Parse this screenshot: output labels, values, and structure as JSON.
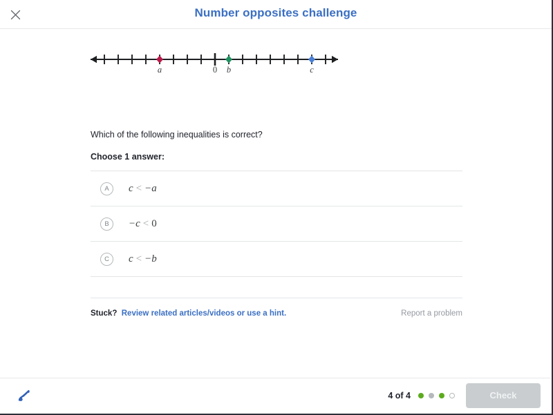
{
  "header": {
    "title": "Number opposites challenge",
    "close_icon": "close-icon"
  },
  "numberline": {
    "zero_label": "0",
    "points": [
      {
        "id": "a",
        "label": "a",
        "value": -4,
        "color": "#b81a4a"
      },
      {
        "id": "b",
        "label": "b",
        "value": 1,
        "color": "#1f9160"
      },
      {
        "id": "c",
        "label": "c",
        "value": 7,
        "color": "#4a7fd4"
      }
    ],
    "tick_min": -8,
    "tick_max": 8,
    "axis_color": "#1d1f21"
  },
  "question": {
    "prompt": "Which of the following inequalities is correct?",
    "choose_label": "Choose 1 answer:"
  },
  "options": [
    {
      "letter": "A",
      "lhs": "c",
      "rel": "<",
      "rhs": "−a"
    },
    {
      "letter": "B",
      "lhs": "−c",
      "rel": "<",
      "rhs": "0"
    },
    {
      "letter": "C",
      "lhs": "c",
      "rel": "<",
      "rhs": "−b"
    }
  ],
  "hint": {
    "stuck_label": "Stuck?",
    "link_text": "Review related articles/videos or use a hint.",
    "report_text": "Report a problem"
  },
  "footer": {
    "pen_icon": "pen-scribble-icon",
    "progress_count": "4 of 4",
    "dots": [
      "correct",
      "neutral",
      "correct",
      "empty"
    ],
    "check_label": "Check"
  },
  "colors": {
    "brand_blue": "#3b6fc3",
    "progress_green": "#5cab1e",
    "disabled_gray": "#c9cdcf"
  }
}
